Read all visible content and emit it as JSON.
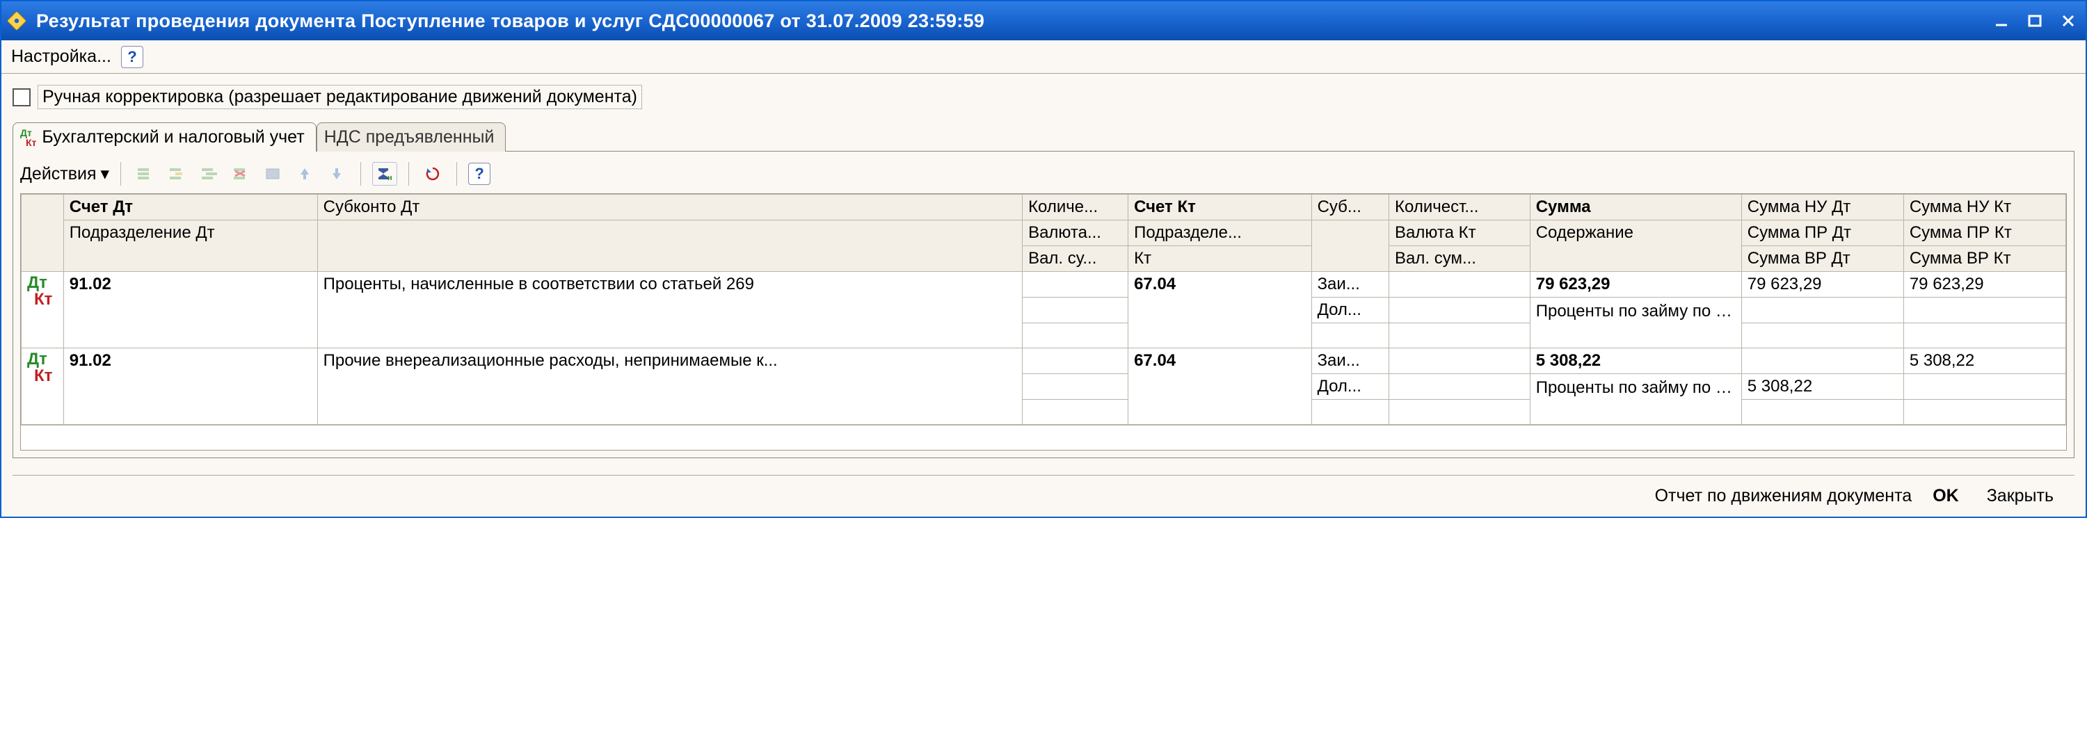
{
  "titlebar": {
    "title": "Результат проведения документа Поступление товаров и услуг СДС00000067 от 31.07.2009 23:59:59"
  },
  "menubar": {
    "settings": "Настройка..."
  },
  "manual_edit": {
    "checked": false,
    "label": "Ручная корректировка (разрешает редактирование движений документа)"
  },
  "tabs": {
    "accounting": "Бухгалтерский и налоговый учет",
    "vat": "НДС предъявленный"
  },
  "panel_toolbar": {
    "actions": "Действия"
  },
  "grid": {
    "headers": {
      "r0": {
        "acct_dt": "Счет Дт",
        "subk_dt": "Субконто Дт",
        "qty_dt": "Количе...",
        "acct_kt": "Счет Кт",
        "subk_kt": "Суб...",
        "qty_kt": "Количест...",
        "amount": "Сумма",
        "nu_dt": "Сумма НУ Дт",
        "nu_kt": "Сумма НУ Кт"
      },
      "r1": {
        "dept_dt": "Подразделение Дт",
        "cur_dt": "Валюта...",
        "dept_kt": "Подразделе...",
        "cur_kt": "Валюта Кт",
        "descr": "Содержание",
        "pr_dt": "Сумма ПР Дт",
        "pr_kt": "Сумма ПР Кт"
      },
      "r2": {
        "curamt_dt": "Вал. су...",
        "kt": "Кт",
        "curamt_kt": "Вал. сум...",
        "vr_dt": "Сумма ВР Дт",
        "vr_kt": "Сумма ВР Кт"
      }
    },
    "rows": [
      {
        "acct_dt": "91.02",
        "subk_dt": "Проценты, начисленные в соответствии со статьей 269",
        "acct_kt": "67.04",
        "subk_kt_l1": "Заи...",
        "subk_kt_l2": "Дол...",
        "amount": "79 623,29",
        "descr": "Проценты по займу по вх.д. от",
        "nu_dt": "79 623,29",
        "nu_kt": "79 623,29"
      },
      {
        "acct_dt": "91.02",
        "subk_dt": "Прочие внереализационные расходы, непринимаемые к...",
        "acct_kt": "67.04",
        "subk_kt_l1": "Заи...",
        "subk_kt_l2": "Дол...",
        "amount": "5 308,22",
        "descr": "Проценты по займу по вх.д. от",
        "pr_dt": "5 308,22",
        "nu_kt": "5 308,22"
      }
    ]
  },
  "buttonbar": {
    "report": "Отчет по движениям документа",
    "ok": "OK",
    "close": "Закрыть"
  }
}
